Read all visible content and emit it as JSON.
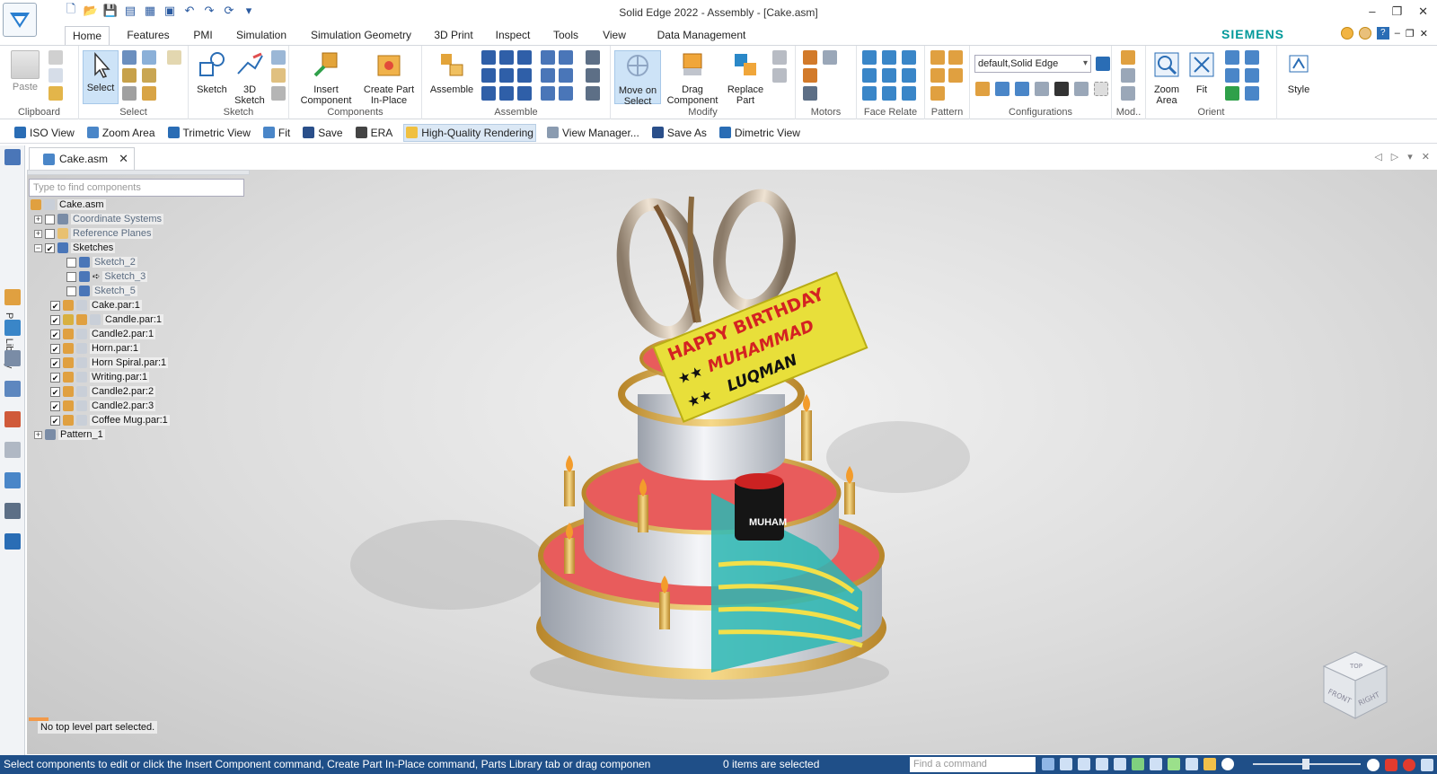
{
  "window": {
    "title": "Solid Edge 2022 - Assembly - [Cake.asm]",
    "brand": "SIEMENS"
  },
  "ribbon_tabs": [
    "Home",
    "Features",
    "PMI",
    "Simulation",
    "Simulation Geometry",
    "3D Print",
    "Inspect",
    "Tools",
    "View",
    "Data Management"
  ],
  "ribbon": {
    "clipboard": {
      "label": "Clipboard",
      "paste": "Paste"
    },
    "select": {
      "label": "Select",
      "select": "Select"
    },
    "sketch": {
      "label": "Sketch",
      "sketch": "Sketch",
      "sketch3d_1": "3D",
      "sketch3d_2": "Sketch"
    },
    "components": {
      "label": "Components",
      "insert_1": "Insert",
      "insert_2": "Component",
      "create_1": "Create Part",
      "create_2": "In-Place"
    },
    "assemble": {
      "label": "Assemble",
      "assemble": "Assemble"
    },
    "modify": {
      "label": "Modify",
      "move_1": "Move on",
      "move_2": "Select",
      "drag_1": "Drag",
      "drag_2": "Component",
      "replace_1": "Replace",
      "replace_2": "Part"
    },
    "motors": {
      "label": "Motors"
    },
    "face_relate": {
      "label": "Face Relate"
    },
    "pattern": {
      "label": "Pattern"
    },
    "configurations": {
      "label": "Configurations",
      "combo_value": "default,Solid Edge"
    },
    "modify_short": {
      "label": "Mod.."
    },
    "orient": {
      "label": "Orient",
      "zoom_area_1": "Zoom",
      "zoom_area_2": "Area",
      "fit": "Fit"
    },
    "style": {
      "label": "Style"
    }
  },
  "command_bar": [
    "ISO View",
    "Zoom Area",
    "Trimetric View",
    "Fit",
    "Save",
    "ERA",
    "High-Quality Rendering",
    "View Manager...",
    "Save As",
    "Dimetric View"
  ],
  "document_tab": "Cake.asm",
  "left_rail_label": "Parts Library",
  "pathfinder": {
    "search_placeholder": "Type to find components",
    "tree": [
      {
        "label": "Cake.asm"
      },
      {
        "label": "Coordinate Systems"
      },
      {
        "label": "Reference Planes"
      },
      {
        "label": "Sketches"
      },
      {
        "label": "Sketch_2"
      },
      {
        "label": "Sketch_3"
      },
      {
        "label": "Sketch_5"
      },
      {
        "label": "Cake.par:1"
      },
      {
        "label": "Candle.par:1"
      },
      {
        "label": "Candle2.par:1"
      },
      {
        "label": "Horn.par:1"
      },
      {
        "label": "Horn Spiral.par:1"
      },
      {
        "label": "Writing.par:1"
      },
      {
        "label": "Candle2.par:2"
      },
      {
        "label": "Candle2.par:3"
      },
      {
        "label": "Coffee Mug.par:1"
      },
      {
        "label": "Pattern_1"
      }
    ]
  },
  "viewport": {
    "no_top_level": "No top level part selected.",
    "banner": {
      "line1": "HAPPY BIRTHDAY",
      "line2": "MUHAMMAD",
      "line3": "LUQMAN",
      "stars": "★★"
    },
    "mug_text": "MUHAM",
    "navcube": {
      "top": "TOP",
      "front": "FRONT",
      "right": "RIGHT"
    }
  },
  "status": {
    "prompt": "Select components to edit or click the Insert Component command, Create Part In-Place command, Parts Library tab or drag componen",
    "selection": "0 items are selected",
    "find_placeholder": "Find a command"
  },
  "colors": {
    "accent": "#2a6db5",
    "brand": "#00999a",
    "status_bg": "#1f4f88",
    "cake_red": "#e85c5c",
    "gold": "#e2b449",
    "teal": "#2bb7b3"
  }
}
